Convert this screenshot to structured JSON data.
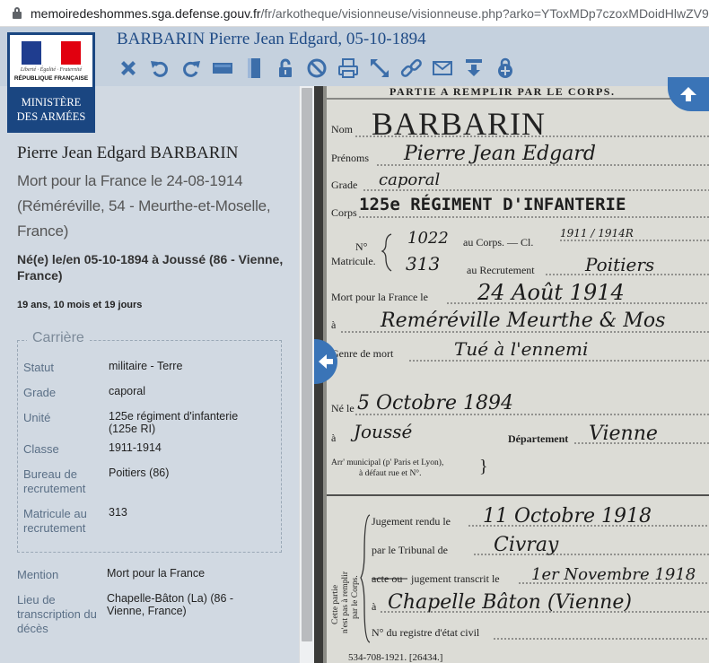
{
  "browser": {
    "url_host": "memoiredeshommes.sga.defense.gouv.fr",
    "url_path": "/fr/arkotheque/visionneuse/visionneuse.php?arko=YToxMDp7czoxMDoidHlwZV9"
  },
  "logo": {
    "devise": "Liberté · Égalité · Fraternité",
    "republique": "RÉPUBLIQUE FRANÇAISE",
    "ministere_line1": "MINISTÈRE",
    "ministere_line2": "DES ARMÉES"
  },
  "header": {
    "title": "BARBARIN Pierre Jean Edgard, 05-10-1894",
    "toolbar": [
      "close-icon",
      "rotate-left-icon",
      "rotate-right-icon",
      "fit-width-icon",
      "fit-height-icon",
      "lock-icon",
      "forbidden-icon",
      "print-icon",
      "fullscreen-icon",
      "link-icon",
      "mail-icon",
      "download-icon",
      "zoom-in-icon"
    ]
  },
  "person": {
    "name": "Pierre Jean Edgard BARBARIN",
    "death": "Mort pour la France le 24-08-1914 (Réméréville, 54 - Meurthe-et-Moselle, France)",
    "birth": "Né(e) le/en 05-10-1894 à Joussé (86 - Vienne, France)",
    "age": "19 ans, 10 mois et 19 jours"
  },
  "carriere": {
    "legend": "Carrière",
    "rows": [
      {
        "label": "Statut",
        "value": "militaire - Terre"
      },
      {
        "label": "Grade",
        "value": "caporal"
      },
      {
        "label": "Unité",
        "value": "125e régiment d'infanterie (125e RI)"
      },
      {
        "label": "Classe",
        "value": "1911-1914"
      },
      {
        "label": "Bureau de recrutement",
        "value": "Poitiers (86)"
      },
      {
        "label": "Matricule au recrutement",
        "value": "313"
      }
    ]
  },
  "extra": {
    "mention_label": "Mention",
    "mention_value": "Mort pour la France",
    "lieu_label": "Lieu de transcription du décès",
    "lieu_value": "Chapelle-Bâton (La) (86 - Vienne, France)"
  },
  "document": {
    "header_text": "PARTIE A REMPLIR PAR LE CORPS.",
    "nom_label": "Nom",
    "nom_value": "BARBARIN",
    "prenoms_label": "Prénoms",
    "prenoms_value": "Pierre Jean Edgard",
    "grade_label": "Grade",
    "grade_value": "caporal",
    "corps_label": "Corps",
    "corps_value": "125e RÉGIMENT D'INFANTERIE",
    "no_label": "N°",
    "matricule_label": "Matricule.",
    "au_corps_label": "au Corps. — Cl.",
    "au_corps_value": "1022",
    "classe_value": "1911 / 1914R",
    "recrutement_label": "au Recrutement",
    "recrutement_no": "313",
    "recrutement_value": "Poitiers",
    "mort_label": "Mort pour la France le",
    "mort_value": "24 Août 1914",
    "a_label": "à",
    "lieu_mort": "Reméréville Meurthe & Mos",
    "genre_label": "Genre de mort",
    "genre_value": "Tué à l'ennemi",
    "ne_label": "Né le",
    "ne_value": "5 Octobre 1894",
    "ne_a_value": "Joussé",
    "departement_label": "Département",
    "departement_value": "Vienne",
    "arr_label_1": "Arr' municipal (p' Paris et Lyon),",
    "arr_label_2": "à défaut rue et N°.",
    "side_label_1": "Cette partie",
    "side_label_2": "n'est pas à remplir",
    "side_label_3": "par le Corps.",
    "jugement_label": "Jugement rendu le",
    "jugement_value": "11 Octobre 1918",
    "tribunal_label": "par le Tribunal de",
    "tribunal_value": "Civray",
    "transcrit_label_strike": "acte ou",
    "transcrit_label": "jugement transcrit le",
    "transcrit_value": "1er Novembre 1918",
    "transcrit_a_value": "Chapelle Bâton (Vienne)",
    "registre_label": "N° du registre d'état civil",
    "footer": "534-708-1921. [26434.]"
  },
  "colors": {
    "header_bg": "#c5d1de",
    "sidebar_bg": "#d1d9e2",
    "ministere_blue": "#1a4681",
    "title_blue": "#1f4b86",
    "icon_blue": "#3c6eaa"
  }
}
